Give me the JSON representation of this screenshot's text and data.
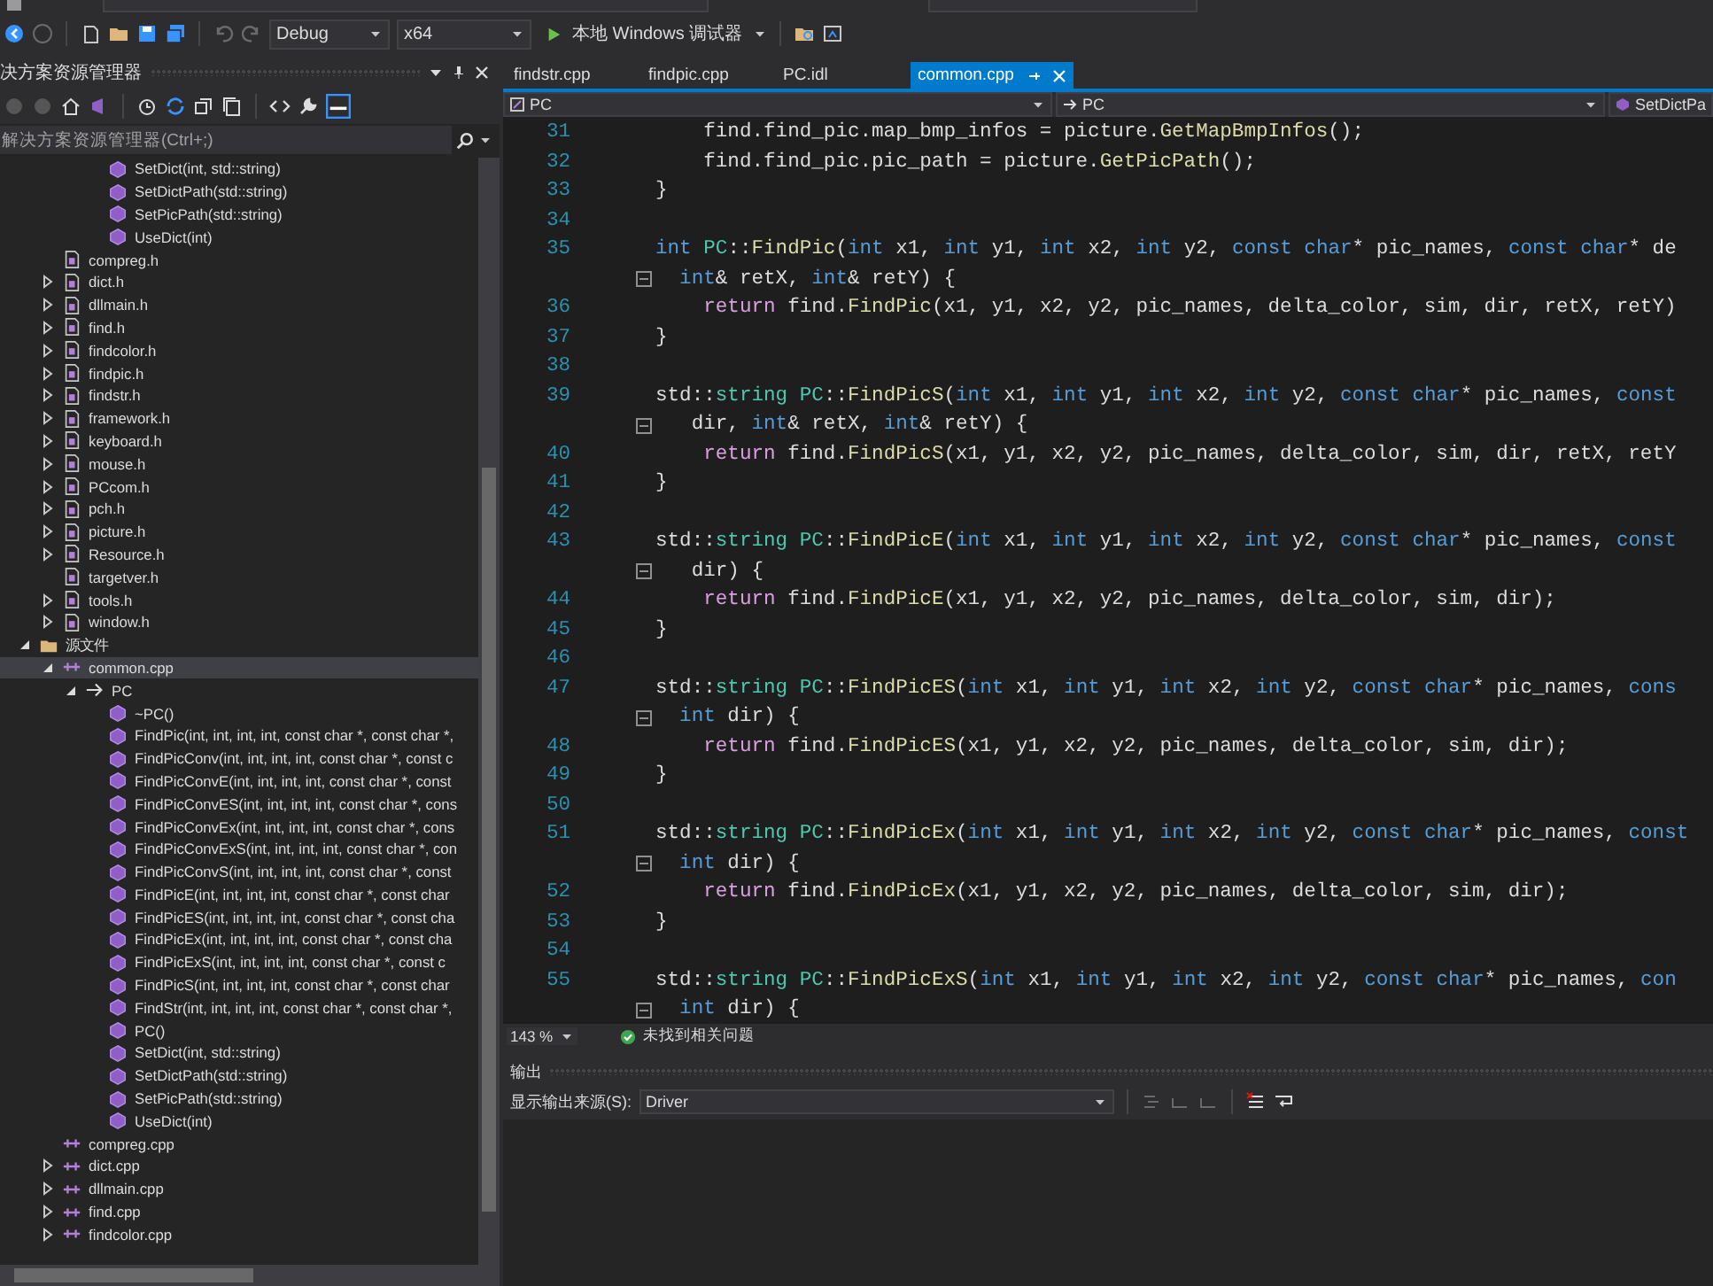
{
  "toolbar": {
    "configuration": "Debug",
    "platform": "x64",
    "run_target": "本地 Windows 调试器"
  },
  "solution_explorer": {
    "title": "决方案资源管理器",
    "search": {
      "placeholder": "解决方案资源管理器(Ctrl+;)"
    },
    "tree_top_members": [
      {
        "label": "SetDict(int, std::string)",
        "selected": false
      },
      {
        "label": "SetDictPath(std::string)",
        "selected": false
      },
      {
        "label": "SetPicPath(std::string)",
        "selected": false
      },
      {
        "label": "UseDict(int)",
        "selected": false
      }
    ],
    "tree_top_files": [
      {
        "label": "compreg.h",
        "expandable": false,
        "selected": false
      },
      {
        "label": "dict.h",
        "expandable": true,
        "expanded": false,
        "selected": false
      },
      {
        "label": "dllmain.h",
        "expandable": true,
        "expanded": false,
        "selected": false
      },
      {
        "label": "find.h",
        "expandable": true,
        "expanded": false,
        "selected": false
      },
      {
        "label": "findcolor.h",
        "expandable": true,
        "expanded": false,
        "selected": false
      },
      {
        "label": "findpic.h",
        "expandable": true,
        "expanded": false,
        "selected": false
      },
      {
        "label": "findstr.h",
        "expandable": true,
        "expanded": false,
        "selected": false
      },
      {
        "label": "framework.h",
        "expandable": true,
        "expanded": false,
        "selected": false
      },
      {
        "label": "keyboard.h",
        "expandable": true,
        "expanded": false,
        "selected": false
      },
      {
        "label": "mouse.h",
        "expandable": true,
        "expanded": false,
        "selected": false
      },
      {
        "label": "PCcom.h",
        "expandable": true,
        "expanded": false,
        "selected": false
      },
      {
        "label": "pch.h",
        "expandable": true,
        "expanded": false,
        "selected": false
      },
      {
        "label": "picture.h",
        "expandable": true,
        "expanded": false,
        "selected": false
      },
      {
        "label": "Resource.h",
        "expandable": true,
        "expanded": false,
        "selected": false
      },
      {
        "label": "targetver.h",
        "expandable": false,
        "selected": false
      },
      {
        "label": "tools.h",
        "expandable": true,
        "expanded": false,
        "selected": false
      },
      {
        "label": "window.h",
        "expandable": true,
        "expanded": false,
        "selected": false
      }
    ],
    "tree": [
      {
        "label": "源文件",
        "kind": "folder",
        "expandable": true,
        "expanded": true,
        "selected": false,
        "children": [
          {
            "label": "common.cpp",
            "kind": "source",
            "expandable": true,
            "expanded": true,
            "selected": true,
            "children": [
              {
                "label": "PC",
                "kind": "class",
                "expandable": true,
                "expanded": true,
                "selected": false,
                "children": [
                  {
                    "label": "~PC()",
                    "kind": "member",
                    "selected": false
                  },
                  {
                    "label": "FindPic(int, int, int, int, const char *, const char *,",
                    "kind": "member",
                    "selected": false
                  },
                  {
                    "label": "FindPicConv(int, int, int, int, const char *, const c",
                    "kind": "member",
                    "selected": false
                  },
                  {
                    "label": "FindPicConvE(int, int, int, int, const char *, const",
                    "kind": "member",
                    "selected": false
                  },
                  {
                    "label": "FindPicConvES(int, int, int, int, const char *, cons",
                    "kind": "member",
                    "selected": false
                  },
                  {
                    "label": "FindPicConvEx(int, int, int, int, const char *, cons",
                    "kind": "member",
                    "selected": false
                  },
                  {
                    "label": "FindPicConvExS(int, int, int, int, const char *, con",
                    "kind": "member",
                    "selected": false
                  },
                  {
                    "label": "FindPicConvS(int, int, int, int, const char *, const",
                    "kind": "member",
                    "selected": false
                  },
                  {
                    "label": "FindPicE(int, int, int, int, const char *, const char",
                    "kind": "member",
                    "selected": false
                  },
                  {
                    "label": "FindPicES(int, int, int, int, const char *, const cha",
                    "kind": "member",
                    "selected": false
                  },
                  {
                    "label": "FindPicEx(int, int, int, int, const char *, const cha",
                    "kind": "member",
                    "selected": false
                  },
                  {
                    "label": "FindPicExS(int, int, int, int, const char *, const c",
                    "kind": "member",
                    "selected": false
                  },
                  {
                    "label": "FindPicS(int, int, int, int, const char *, const char",
                    "kind": "member",
                    "selected": false
                  },
                  {
                    "label": "FindStr(int, int, int, int, const char *, const char *,",
                    "kind": "member",
                    "selected": false
                  },
                  {
                    "label": "PC()",
                    "kind": "member",
                    "selected": false
                  },
                  {
                    "label": "SetDict(int, std::string)",
                    "kind": "member",
                    "selected": false
                  },
                  {
                    "label": "SetDictPath(std::string)",
                    "kind": "member",
                    "selected": false
                  },
                  {
                    "label": "SetPicPath(std::string)",
                    "kind": "member",
                    "selected": false
                  },
                  {
                    "label": "UseDict(int)",
                    "kind": "member",
                    "selected": false
                  }
                ]
              }
            ]
          },
          {
            "label": "compreg.cpp",
            "kind": "source",
            "expandable": false,
            "selected": false
          },
          {
            "label": "dict.cpp",
            "kind": "source",
            "expandable": true,
            "expanded": false,
            "selected": false
          },
          {
            "label": "dllmain.cpp",
            "kind": "source",
            "expandable": true,
            "expanded": false,
            "selected": false
          },
          {
            "label": "find.cpp",
            "kind": "source",
            "expandable": true,
            "expanded": false,
            "selected": false
          },
          {
            "label": "findcolor.cpp",
            "kind": "source",
            "expandable": true,
            "expanded": false,
            "selected": false
          }
        ]
      }
    ]
  },
  "editor": {
    "tabs": [
      {
        "label": "findstr.cpp",
        "selected": false
      },
      {
        "label": "findpic.cpp",
        "selected": false
      },
      {
        "label": "PC.idl",
        "selected": false
      },
      {
        "label": "common.cpp",
        "selected": true
      }
    ],
    "nav": {
      "scope": "PC",
      "member": "PC",
      "function": "SetDictPa"
    },
    "lines": [
      {
        "kind": "line",
        "number": "31",
        "spans": [
          {
            "kind": "t",
            "text": "    find.find_pic.map_bmp_infos = picture."
          },
          {
            "kind": "f",
            "text": "GetMapBmpInfos"
          },
          {
            "kind": "t",
            "text": "();"
          }
        ]
      },
      {
        "kind": "line",
        "number": "32",
        "spans": [
          {
            "kind": "t",
            "text": "    find.find_pic.pic_path = picture."
          },
          {
            "kind": "f",
            "text": "GetPicPath"
          },
          {
            "kind": "t",
            "text": "();"
          }
        ]
      },
      {
        "kind": "line",
        "number": "33",
        "spans": [
          {
            "kind": "t",
            "text": "}"
          }
        ]
      },
      {
        "kind": "line",
        "number": "34"
      },
      {
        "kind": "line",
        "number": "35",
        "spans": [
          {
            "kind": "k",
            "text": "int "
          },
          {
            "kind": "c",
            "text": "PC"
          },
          {
            "kind": "t",
            "text": "::"
          },
          {
            "kind": "f",
            "text": "FindPic"
          },
          {
            "kind": "t",
            "text": "("
          },
          {
            "kind": "k",
            "text": "int"
          },
          {
            "kind": "t",
            "text": " x1, "
          },
          {
            "kind": "k",
            "text": "int"
          },
          {
            "kind": "t",
            "text": " y1, "
          },
          {
            "kind": "k",
            "text": "int"
          },
          {
            "kind": "t",
            "text": " x2, "
          },
          {
            "kind": "k",
            "text": "int"
          },
          {
            "kind": "t",
            "text": " y2, "
          },
          {
            "kind": "k",
            "text": "const char"
          },
          {
            "kind": "t",
            "text": "* pic_names, "
          },
          {
            "kind": "k",
            "text": "const char"
          },
          {
            "kind": "t",
            "text": "* de"
          }
        ]
      },
      {
        "kind": "wrap",
        "spans": [
          {
            "kind": "k",
            "text": "  int"
          },
          {
            "kind": "t",
            "text": "& retX, "
          },
          {
            "kind": "k",
            "text": "int"
          },
          {
            "kind": "t",
            "text": "& retY) {"
          }
        ]
      },
      {
        "kind": "line",
        "number": "36",
        "spans": [
          {
            "kind": "r",
            "text": "    return"
          },
          {
            "kind": "t",
            "text": " find."
          },
          {
            "kind": "f",
            "text": "FindPic"
          },
          {
            "kind": "t",
            "text": "(x1, y1, x2, y2, pic_names, delta_color, sim, dir, retX, retY)"
          }
        ]
      },
      {
        "kind": "line",
        "number": "37",
        "spans": [
          {
            "kind": "t",
            "text": "}"
          }
        ]
      },
      {
        "kind": "line",
        "number": "38"
      },
      {
        "kind": "line",
        "number": "39",
        "spans": [
          {
            "kind": "t",
            "text": "std::"
          },
          {
            "kind": "c",
            "text": "string"
          },
          {
            "kind": "c",
            "text": " PC"
          },
          {
            "kind": "t",
            "text": "::"
          },
          {
            "kind": "f",
            "text": "FindPicS"
          },
          {
            "kind": "t",
            "text": "("
          },
          {
            "kind": "k",
            "text": "int"
          },
          {
            "kind": "t",
            "text": " x1, "
          },
          {
            "kind": "k",
            "text": "int"
          },
          {
            "kind": "t",
            "text": " y1, "
          },
          {
            "kind": "k",
            "text": "int"
          },
          {
            "kind": "t",
            "text": " x2, "
          },
          {
            "kind": "k",
            "text": "int"
          },
          {
            "kind": "t",
            "text": " y2, "
          },
          {
            "kind": "k",
            "text": "const char"
          },
          {
            "kind": "t",
            "text": "* pic_names, "
          },
          {
            "kind": "k",
            "text": "const"
          }
        ]
      },
      {
        "kind": "wrap",
        "spans": [
          {
            "kind": "t",
            "text": "   dir, "
          },
          {
            "kind": "k",
            "text": "int"
          },
          {
            "kind": "t",
            "text": "& retX, "
          },
          {
            "kind": "k",
            "text": "int"
          },
          {
            "kind": "t",
            "text": "& retY) {"
          }
        ]
      },
      {
        "kind": "line",
        "number": "40",
        "spans": [
          {
            "kind": "r",
            "text": "    return"
          },
          {
            "kind": "t",
            "text": " find."
          },
          {
            "kind": "f",
            "text": "FindPicS"
          },
          {
            "kind": "t",
            "text": "(x1, y1, x2, y2, pic_names, delta_color, sim, dir, retX, retY"
          }
        ]
      },
      {
        "kind": "line",
        "number": "41",
        "spans": [
          {
            "kind": "t",
            "text": "}"
          }
        ]
      },
      {
        "kind": "line",
        "number": "42"
      },
      {
        "kind": "line",
        "number": "43",
        "spans": [
          {
            "kind": "t",
            "text": "std::"
          },
          {
            "kind": "c",
            "text": "string"
          },
          {
            "kind": "c",
            "text": " PC"
          },
          {
            "kind": "t",
            "text": "::"
          },
          {
            "kind": "f",
            "text": "FindPicE"
          },
          {
            "kind": "t",
            "text": "("
          },
          {
            "kind": "k",
            "text": "int"
          },
          {
            "kind": "t",
            "text": " x1, "
          },
          {
            "kind": "k",
            "text": "int"
          },
          {
            "kind": "t",
            "text": " y1, "
          },
          {
            "kind": "k",
            "text": "int"
          },
          {
            "kind": "t",
            "text": " x2, "
          },
          {
            "kind": "k",
            "text": "int"
          },
          {
            "kind": "t",
            "text": " y2, "
          },
          {
            "kind": "k",
            "text": "const char"
          },
          {
            "kind": "t",
            "text": "* pic_names, "
          },
          {
            "kind": "k",
            "text": "const"
          }
        ]
      },
      {
        "kind": "wrap",
        "spans": [
          {
            "kind": "t",
            "text": "   dir) {"
          }
        ]
      },
      {
        "kind": "line",
        "number": "44",
        "spans": [
          {
            "kind": "r",
            "text": "    return"
          },
          {
            "kind": "t",
            "text": " find."
          },
          {
            "kind": "f",
            "text": "FindPicE"
          },
          {
            "kind": "t",
            "text": "(x1, y1, x2, y2, pic_names, delta_color, sim, dir);"
          }
        ]
      },
      {
        "kind": "line",
        "number": "45",
        "spans": [
          {
            "kind": "t",
            "text": "}"
          }
        ]
      },
      {
        "kind": "line",
        "number": "46"
      },
      {
        "kind": "line",
        "number": "47",
        "spans": [
          {
            "kind": "t",
            "text": "std::"
          },
          {
            "kind": "c",
            "text": "string"
          },
          {
            "kind": "c",
            "text": " PC"
          },
          {
            "kind": "t",
            "text": "::"
          },
          {
            "kind": "f",
            "text": "FindPicES"
          },
          {
            "kind": "t",
            "text": "("
          },
          {
            "kind": "k",
            "text": "int"
          },
          {
            "kind": "t",
            "text": " x1, "
          },
          {
            "kind": "k",
            "text": "int"
          },
          {
            "kind": "t",
            "text": " y1, "
          },
          {
            "kind": "k",
            "text": "int"
          },
          {
            "kind": "t",
            "text": " x2, "
          },
          {
            "kind": "k",
            "text": "int"
          },
          {
            "kind": "t",
            "text": " y2, "
          },
          {
            "kind": "k",
            "text": "const char"
          },
          {
            "kind": "t",
            "text": "* pic_names, "
          },
          {
            "kind": "k",
            "text": "cons"
          }
        ]
      },
      {
        "kind": "wrap",
        "spans": [
          {
            "kind": "k",
            "text": "  int"
          },
          {
            "kind": "t",
            "text": " dir) {"
          }
        ]
      },
      {
        "kind": "line",
        "number": "48",
        "spans": [
          {
            "kind": "r",
            "text": "    return"
          },
          {
            "kind": "t",
            "text": " find."
          },
          {
            "kind": "f",
            "text": "FindPicES"
          },
          {
            "kind": "t",
            "text": "(x1, y1, x2, y2, pic_names, delta_color, sim, dir);"
          }
        ]
      },
      {
        "kind": "line",
        "number": "49",
        "spans": [
          {
            "kind": "t",
            "text": "}"
          }
        ]
      },
      {
        "kind": "line",
        "number": "50"
      },
      {
        "kind": "line",
        "number": "51",
        "spans": [
          {
            "kind": "t",
            "text": "std::"
          },
          {
            "kind": "c",
            "text": "string"
          },
          {
            "kind": "c",
            "text": " PC"
          },
          {
            "kind": "t",
            "text": "::"
          },
          {
            "kind": "f",
            "text": "FindPicEx"
          },
          {
            "kind": "t",
            "text": "("
          },
          {
            "kind": "k",
            "text": "int"
          },
          {
            "kind": "t",
            "text": " x1, "
          },
          {
            "kind": "k",
            "text": "int"
          },
          {
            "kind": "t",
            "text": " y1, "
          },
          {
            "kind": "k",
            "text": "int"
          },
          {
            "kind": "t",
            "text": " x2, "
          },
          {
            "kind": "k",
            "text": "int"
          },
          {
            "kind": "t",
            "text": " y2, "
          },
          {
            "kind": "k",
            "text": "const char"
          },
          {
            "kind": "t",
            "text": "* pic_names, "
          },
          {
            "kind": "k",
            "text": "const"
          }
        ]
      },
      {
        "kind": "wrap",
        "spans": [
          {
            "kind": "k",
            "text": "  int"
          },
          {
            "kind": "t",
            "text": " dir) {"
          }
        ]
      },
      {
        "kind": "line",
        "number": "52",
        "spans": [
          {
            "kind": "r",
            "text": "    return"
          },
          {
            "kind": "t",
            "text": " find."
          },
          {
            "kind": "f",
            "text": "FindPicEx"
          },
          {
            "kind": "t",
            "text": "(x1, y1, x2, y2, pic_names, delta_color, sim, dir);"
          }
        ]
      },
      {
        "kind": "line",
        "number": "53",
        "spans": [
          {
            "kind": "t",
            "text": "}"
          }
        ]
      },
      {
        "kind": "line",
        "number": "54"
      },
      {
        "kind": "line",
        "number": "55",
        "spans": [
          {
            "kind": "t",
            "text": "std::"
          },
          {
            "kind": "c",
            "text": "string"
          },
          {
            "kind": "c",
            "text": " PC"
          },
          {
            "kind": "t",
            "text": "::"
          },
          {
            "kind": "f",
            "text": "FindPicExS"
          },
          {
            "kind": "t",
            "text": "("
          },
          {
            "kind": "k",
            "text": "int"
          },
          {
            "kind": "t",
            "text": " x1, "
          },
          {
            "kind": "k",
            "text": "int"
          },
          {
            "kind": "t",
            "text": " y1, "
          },
          {
            "kind": "k",
            "text": "int"
          },
          {
            "kind": "t",
            "text": " x2, "
          },
          {
            "kind": "k",
            "text": "int"
          },
          {
            "kind": "t",
            "text": " y2, "
          },
          {
            "kind": "k",
            "text": "const char"
          },
          {
            "kind": "t",
            "text": "* pic_names, "
          },
          {
            "kind": "k",
            "text": "con"
          }
        ]
      },
      {
        "kind": "wrap",
        "spans": [
          {
            "kind": "k",
            "text": "  int"
          },
          {
            "kind": "t",
            "text": " dir) {"
          }
        ]
      }
    ],
    "zoom": "143 %",
    "issues": "未找到相关问题"
  },
  "output": {
    "title": "输出",
    "source_label": "显示输出来源(S):",
    "source": "Driver"
  }
}
